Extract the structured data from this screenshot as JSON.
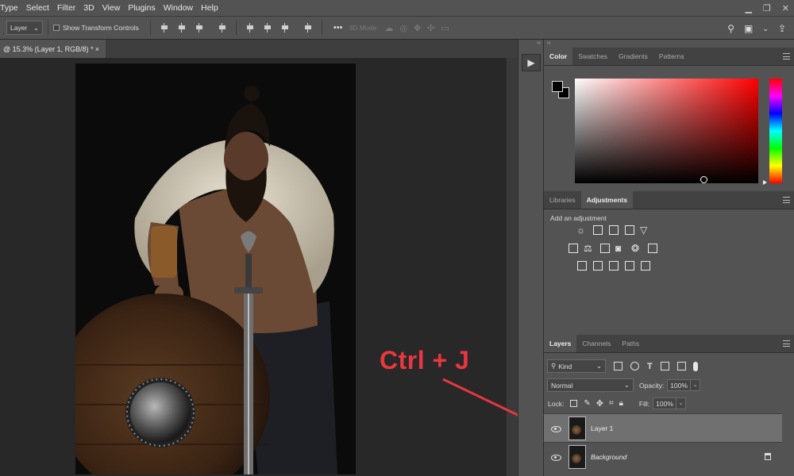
{
  "menu": [
    "Type",
    "Select",
    "Filter",
    "3D",
    "View",
    "Plugins",
    "Window",
    "Help"
  ],
  "window_controls": {
    "minimize": "▁",
    "restore": "❐",
    "close": "✕"
  },
  "options": {
    "auto_select": "Layer",
    "show_transform": "Show Transform Controls",
    "more": "•••",
    "mode_3d": "3D Mode:"
  },
  "document": {
    "tab_title": "@ 15.3% (Layer 1, RGB/8) *",
    "close": "×"
  },
  "annotation": {
    "shortcut": "Ctrl + J",
    "color": "#e8373f"
  },
  "color_panel": {
    "tabs": [
      "Color",
      "Swatches",
      "Gradients",
      "Patterns"
    ],
    "active_tab": "Color",
    "hue_color": "#ff0000"
  },
  "adjustments_panel": {
    "tabs": [
      "Libraries",
      "Adjustments"
    ],
    "active_tab": "Adjustments",
    "add_label": "Add an adjustment"
  },
  "layers_panel": {
    "tabs": [
      "Layers",
      "Channels",
      "Paths"
    ],
    "active_tab": "Layers",
    "kind_filter": "Kind",
    "blend_mode": "Normal",
    "opacity_label": "Opacity:",
    "opacity_value": "100%",
    "lock_label": "Lock:",
    "fill_label": "Fill:",
    "fill_value": "100%",
    "layers": [
      {
        "name": "Layer 1",
        "selected": true,
        "visible": true
      },
      {
        "name": "Background",
        "selected": false,
        "visible": true,
        "locked": true
      }
    ]
  }
}
